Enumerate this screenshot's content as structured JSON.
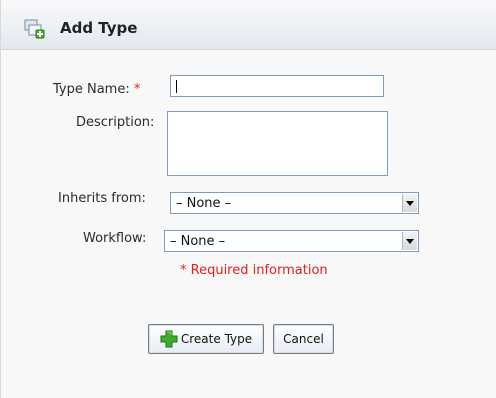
{
  "dialog": {
    "title": "Add Type"
  },
  "form": {
    "type_name": {
      "label": "Type Name:",
      "required_marker": "*",
      "value": ""
    },
    "description": {
      "label": "Description:",
      "value": ""
    },
    "inherits_from": {
      "label": "Inherits from:",
      "selected": "– None –"
    },
    "workflow": {
      "label": "Workflow:",
      "selected": "– None –"
    },
    "required_note": "* Required information"
  },
  "buttons": {
    "create_label": "Create Type",
    "cancel_label": "Cancel"
  },
  "icons": {
    "header": "add-type-icon",
    "create": "green-plus-icon",
    "dropdown": "chevron-down-icon"
  },
  "colors": {
    "required": "#e0211b",
    "header_bg": "#e9edf2",
    "button_border": "#7a7a7a"
  }
}
